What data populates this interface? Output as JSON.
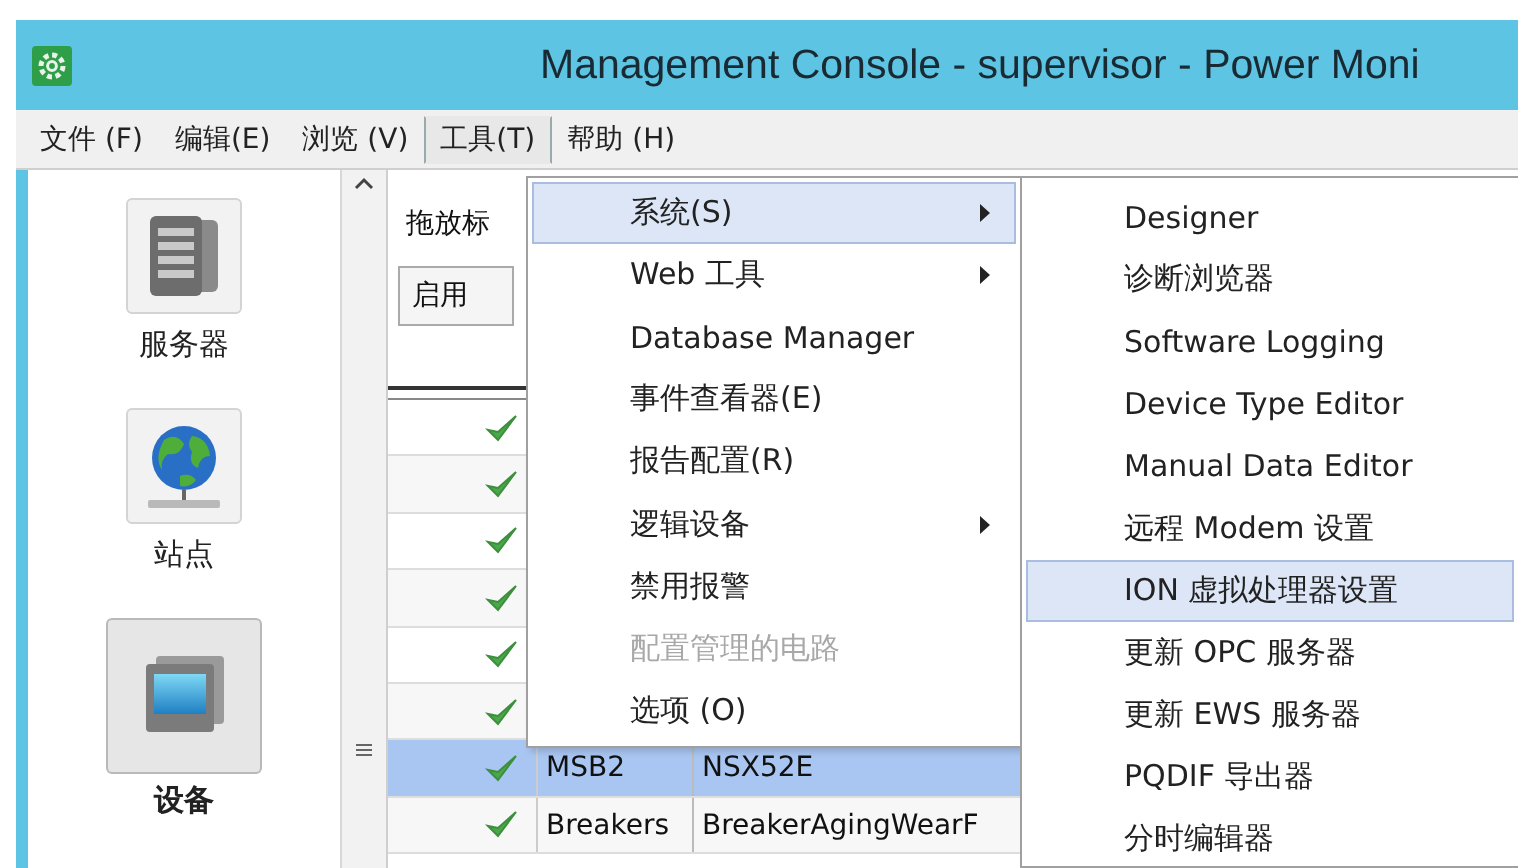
{
  "window": {
    "title": "Management Console - supervisor - Power Moni"
  },
  "menubar": [
    {
      "label": "文件 (F)",
      "selected": false
    },
    {
      "label": "编辑(E)",
      "selected": false
    },
    {
      "label": "浏览 (V)",
      "selected": false
    },
    {
      "label": "工具(T)",
      "selected": true
    },
    {
      "label": "帮助 (H)",
      "selected": false
    }
  ],
  "sidebar": {
    "items": [
      {
        "label": "服务器",
        "kind": "server",
        "selected": false
      },
      {
        "label": "站点",
        "kind": "site",
        "selected": false
      },
      {
        "label": "设备",
        "kind": "device",
        "selected": true
      }
    ]
  },
  "filter": {
    "label": "拖放标",
    "value": "启用"
  },
  "table": {
    "rows": [
      {
        "checked": true,
        "selected": false
      },
      {
        "checked": true,
        "selected": false
      },
      {
        "checked": true,
        "selected": false
      },
      {
        "checked": true,
        "selected": false
      },
      {
        "checked": true,
        "selected": false
      },
      {
        "checked": true,
        "selected": false
      },
      {
        "checked": true,
        "selected": true,
        "column_2": "MSB2",
        "column_3": "NSX52E"
      },
      {
        "checked": true,
        "selected": false,
        "column_2": "Breakers",
        "column_3": "BreakerAgingWearF"
      }
    ]
  },
  "tools_menu": [
    {
      "label": "系统(S)",
      "submenu": true,
      "disabled": false,
      "selected": true
    },
    {
      "label": "Web 工具",
      "submenu": true,
      "disabled": false,
      "selected": false
    },
    {
      "label": "Database Manager",
      "submenu": false,
      "disabled": false,
      "selected": false
    },
    {
      "label": "事件查看器(E)",
      "submenu": false,
      "disabled": false,
      "selected": false
    },
    {
      "label": "报告配置(R)",
      "submenu": false,
      "disabled": false,
      "selected": false
    },
    {
      "label": "逻辑设备",
      "submenu": true,
      "disabled": false,
      "selected": false
    },
    {
      "label": "禁用报警",
      "submenu": false,
      "disabled": false,
      "selected": false
    },
    {
      "label": "配置管理的电路",
      "submenu": false,
      "disabled": true,
      "selected": false
    },
    {
      "label": "选项 (O)",
      "submenu": false,
      "disabled": false,
      "selected": false
    }
  ],
  "system_submenu": [
    {
      "label": "Designer",
      "submenu": false,
      "disabled": false,
      "selected": false
    },
    {
      "label": "诊断浏览器",
      "submenu": false,
      "disabled": false,
      "selected": false
    },
    {
      "label": "Software Logging",
      "submenu": false,
      "disabled": false,
      "selected": false
    },
    {
      "label": "Device Type Editor",
      "submenu": false,
      "disabled": false,
      "selected": false
    },
    {
      "label": "Manual Data Editor",
      "submenu": false,
      "disabled": false,
      "selected": false
    },
    {
      "label": "远程 Modem 设置",
      "submenu": false,
      "disabled": false,
      "selected": false
    },
    {
      "label": "ION 虚拟处理器设置",
      "submenu": false,
      "disabled": false,
      "selected": true
    },
    {
      "label": "更新 OPC 服务器",
      "submenu": false,
      "disabled": false,
      "selected": false
    },
    {
      "label": "更新 EWS 服务器",
      "submenu": false,
      "disabled": false,
      "selected": false
    },
    {
      "label": "PQDIF 导出器",
      "submenu": false,
      "disabled": false,
      "selected": false
    },
    {
      "label": "分时编辑器",
      "submenu": false,
      "disabled": false,
      "selected": false
    }
  ]
}
